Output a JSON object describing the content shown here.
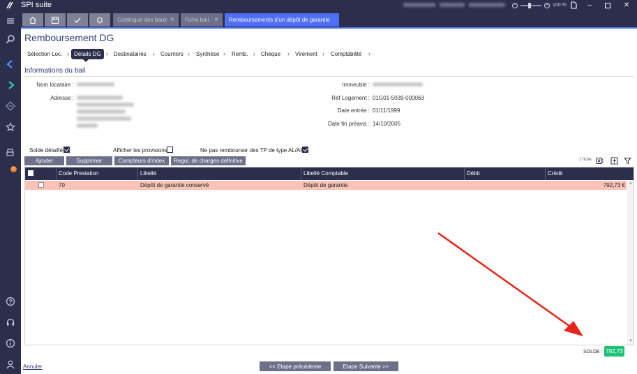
{
  "app": {
    "title": "SPI suite",
    "zoom": "100 %"
  },
  "tabs": [
    {
      "label": "Catalogue des baux"
    },
    {
      "label": "Fiche bail"
    },
    {
      "label": "Remboursements d'un dépôt de garantie"
    }
  ],
  "page": {
    "title": "Remboursement DG"
  },
  "breadcrumb": [
    {
      "label": "Sélection Loc."
    },
    {
      "label": "Détails DG"
    },
    {
      "label": "Destinataires"
    },
    {
      "label": "Courriers"
    },
    {
      "label": "Synthèse"
    },
    {
      "label": "Remb."
    },
    {
      "label": "Chèque"
    },
    {
      "label": "Virement"
    },
    {
      "label": "Comptabilité"
    }
  ],
  "bail": {
    "section_title": "Informations du bail",
    "nom_label": "Nom locataire :",
    "adresse_label": "Adresse :",
    "immeuble_label": "Immeuble :",
    "ref_label": "Réf Logement :",
    "ref_value": "01G01-5039-000063",
    "entree_label": "Date entrée :",
    "entree_value": "01/11/1999",
    "fin_label": "Date fin préavis :",
    "fin_value": "14/10/2005"
  },
  "options": {
    "solde_detaille": "Solde détaillé",
    "afficher_provisions": "Afficher les provisions",
    "ne_pas_rembourser": "Ne pas rembourser des TP de type AL/APL"
  },
  "actions": {
    "ajouter": "Ajouter",
    "supprimer": "Supprimer",
    "compteurs": "Compteurs d'index",
    "regul": "Regul. de charges définitive"
  },
  "toolbar": {
    "count": "1 fiche"
  },
  "grid": {
    "columns": {
      "code": "Code Prestation",
      "libelle": "Libellé",
      "libelle_comptable": "Libellé Comptable",
      "debit": "Débit",
      "credit": "Crédit"
    },
    "rows": [
      {
        "code": "70",
        "libelle": "Dépôt de garantie conservé",
        "libelle_comptable": "Dépôt de garantie",
        "debit": "",
        "credit": "792,73 €"
      }
    ]
  },
  "solde": {
    "label": "SOLDE :",
    "value": "792,73"
  },
  "footer": {
    "annuler": "Annuler",
    "prev": "<< Etape précédente",
    "next": "Etape Suivante >>"
  },
  "colors": {
    "accent": "#4f6ff5",
    "navy": "#2b2f4c",
    "highlight_row": "#f8c2b5",
    "solde": "#1fc37a",
    "arrow": "#e8231a"
  }
}
